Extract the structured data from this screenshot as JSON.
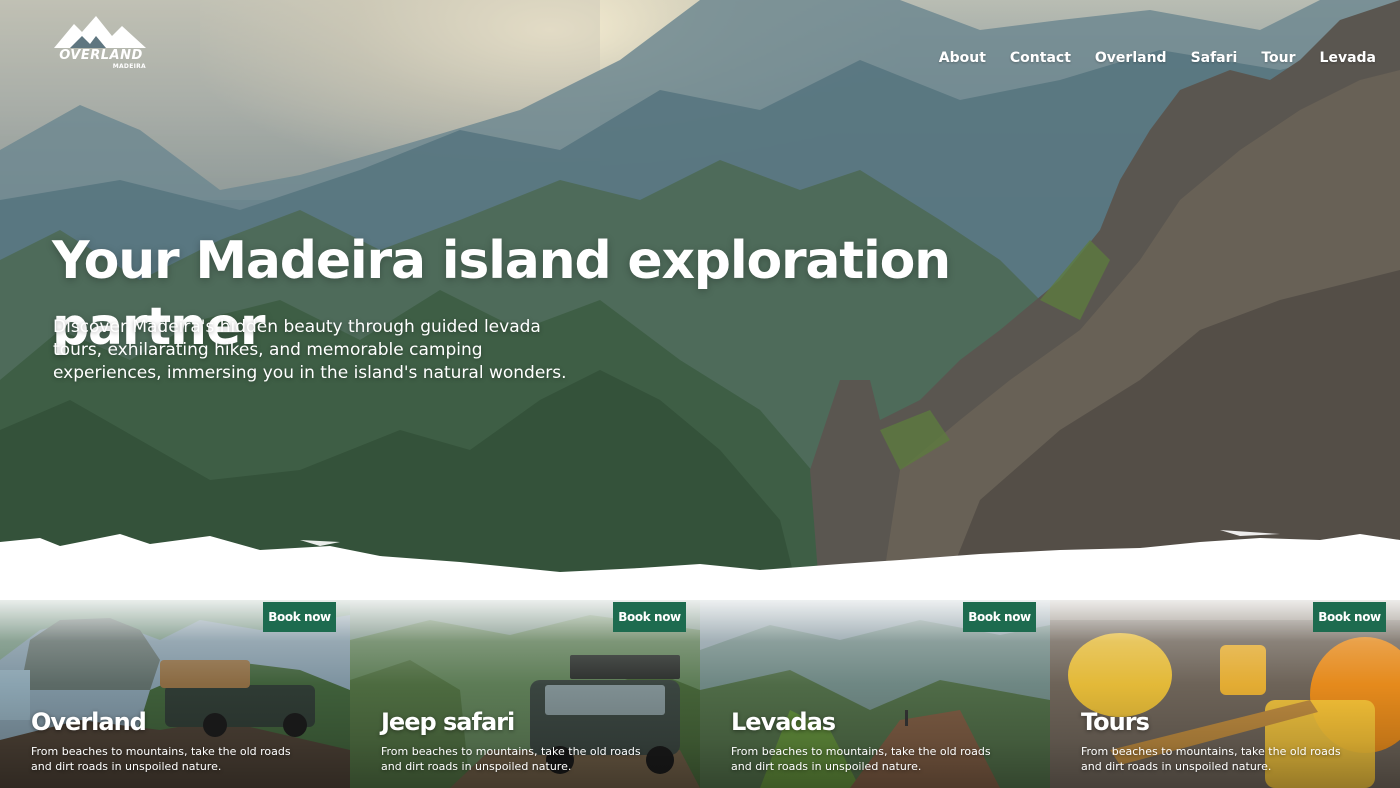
{
  "brand": {
    "name": "OVERLAND",
    "subtitle": "MADEIRA"
  },
  "nav": {
    "items": [
      {
        "label": "About"
      },
      {
        "label": "Contact"
      },
      {
        "label": "Overland"
      },
      {
        "label": "Safari"
      },
      {
        "label": "Tour"
      },
      {
        "label": "Levada"
      }
    ]
  },
  "hero": {
    "title": "Your Madeira island exploration partner",
    "description": "Discover Madeira's hidden beauty through guided levada tours, exhilarating hikes, and memorable camping experiences, immersing you in the island's natural wonders."
  },
  "cards": [
    {
      "title": "Overland",
      "description": "From beaches to mountains, take the old roads and dirt roads in unspoiled nature.",
      "button": "Book now"
    },
    {
      "title": "Jeep safari",
      "description": "From beaches to mountains, take the old roads and dirt roads in unspoiled nature.",
      "button": "Book now"
    },
    {
      "title": "Levadas",
      "description": "From beaches to mountains, take the old roads and dirt roads in unspoiled nature.",
      "button": "Book now"
    },
    {
      "title": "Tours",
      "description": "From beaches to mountains, take the old roads and dirt roads in unspoiled nature.",
      "button": "Book now"
    }
  ],
  "colors": {
    "accent": "#1d6b4f",
    "text_light": "#ffffff"
  }
}
